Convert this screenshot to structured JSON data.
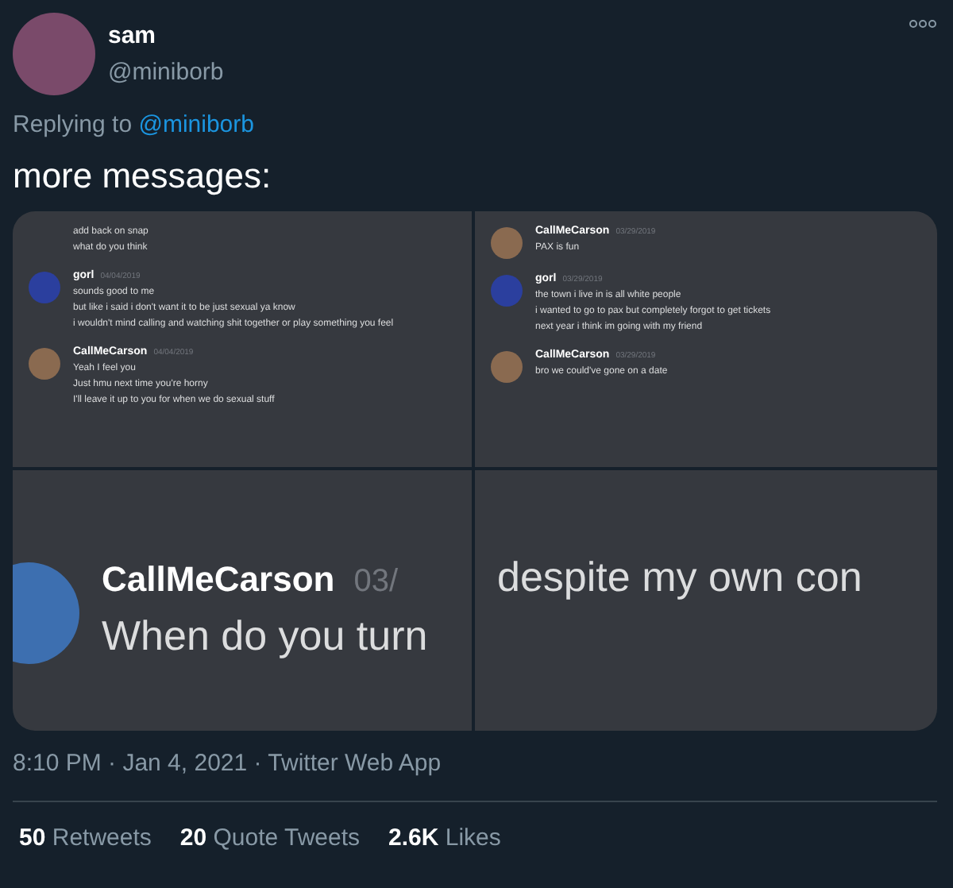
{
  "author": {
    "name": "sam",
    "handle": "@miniborb"
  },
  "reply": {
    "prefix": "Replying to",
    "handle": "@miniborb"
  },
  "text": "more messages:",
  "media": [
    {
      "kind": "small",
      "messages": [
        {
          "lines": [
            "add back on snap",
            "what do you think"
          ]
        },
        {
          "author": "gorl",
          "date": "04/04/2019",
          "color": "#2b3f9e",
          "lines": [
            "sounds good to me",
            "but like i said i don't want it to be just sexual ya know",
            "i wouldn't mind calling and watching shit together or play something you feel"
          ]
        },
        {
          "author": "CallMeCarson",
          "date": "04/04/2019",
          "color": "#8a6a50",
          "lines": [
            "Yeah I feel you",
            "Just hmu next time you're horny",
            "I'll leave it up to you for when we do sexual stuff"
          ]
        }
      ]
    },
    {
      "kind": "small",
      "messages": [
        {
          "author": "CallMeCarson",
          "date": "03/29/2019",
          "color": "#8a6a50",
          "lines": [
            "PAX is fun"
          ]
        },
        {
          "author": "gorl",
          "date": "03/29/2019",
          "color": "#2b3f9e",
          "lines": [
            "the town i live in is all white people",
            "i wanted to go to pax but completely forgot to get tickets",
            "next year i think im going with my friend"
          ]
        },
        {
          "author": "CallMeCarson",
          "date": "03/29/2019",
          "color": "#8a6a50",
          "lines": [
            "bro we could've gone on a date"
          ]
        }
      ]
    },
    {
      "kind": "zoomed",
      "messages": [
        {
          "author": "CallMeCarson",
          "date": "03/",
          "color": "#3d6fb0",
          "lines": [
            "When do you turn"
          ]
        }
      ]
    },
    {
      "kind": "zoomed",
      "messages": [
        {
          "lines": [
            "despite my own con"
          ]
        }
      ]
    }
  ],
  "timestamp": "8:10 PM · Jan 4, 2021 · Twitter Web App",
  "stats": [
    {
      "count": "50",
      "label": "Retweets"
    },
    {
      "count": "20",
      "label": "Quote Tweets"
    },
    {
      "count": "2.6K",
      "label": "Likes"
    }
  ]
}
